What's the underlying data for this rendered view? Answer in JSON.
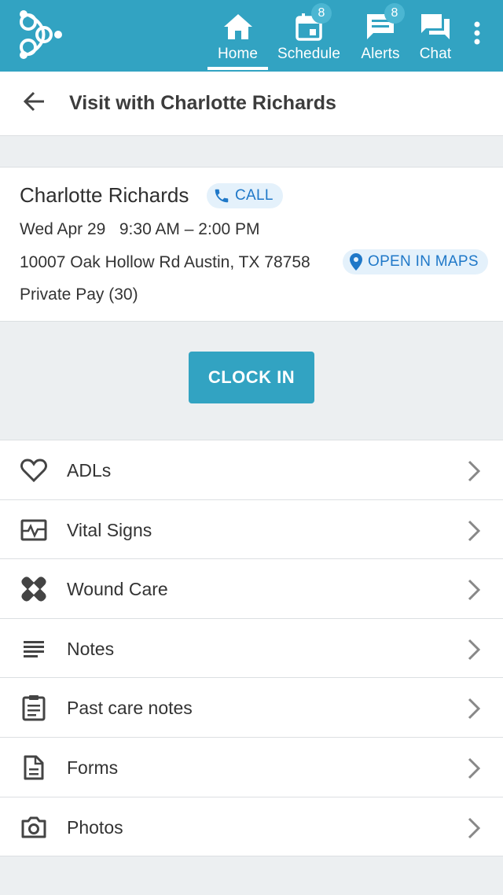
{
  "nav": {
    "items": [
      {
        "label": "Home",
        "icon": "home-icon"
      },
      {
        "label": "Schedule",
        "icon": "calendar-icon",
        "badge": "8"
      },
      {
        "label": "Alerts",
        "icon": "alerts-icon",
        "badge": "8"
      },
      {
        "label": "Chat",
        "icon": "chat-icon"
      }
    ],
    "more_icon": "more-vertical-icon",
    "accent": "#32a3c2"
  },
  "header": {
    "title": "Visit with Charlotte Richards"
  },
  "visit": {
    "client_name": "Charlotte Richards",
    "call_label": "CALL",
    "date": "Wed Apr 29",
    "time": "9:30 AM – 2:00 PM",
    "address": "10007 Oak Hollow Rd Austin, TX 78758",
    "maps_label": "OPEN IN MAPS",
    "payer": "Private Pay (30)"
  },
  "clock_in_label": "CLOCK IN",
  "menu": [
    {
      "label": "ADLs",
      "icon": "heart-icon"
    },
    {
      "label": "Vital Signs",
      "icon": "vital-signs-icon"
    },
    {
      "label": "Wound Care",
      "icon": "bandage-icon"
    },
    {
      "label": "Notes",
      "icon": "notes-icon"
    },
    {
      "label": "Past care notes",
      "icon": "clipboard-icon"
    },
    {
      "label": "Forms",
      "icon": "document-icon"
    },
    {
      "label": "Photos",
      "icon": "camera-icon"
    }
  ]
}
